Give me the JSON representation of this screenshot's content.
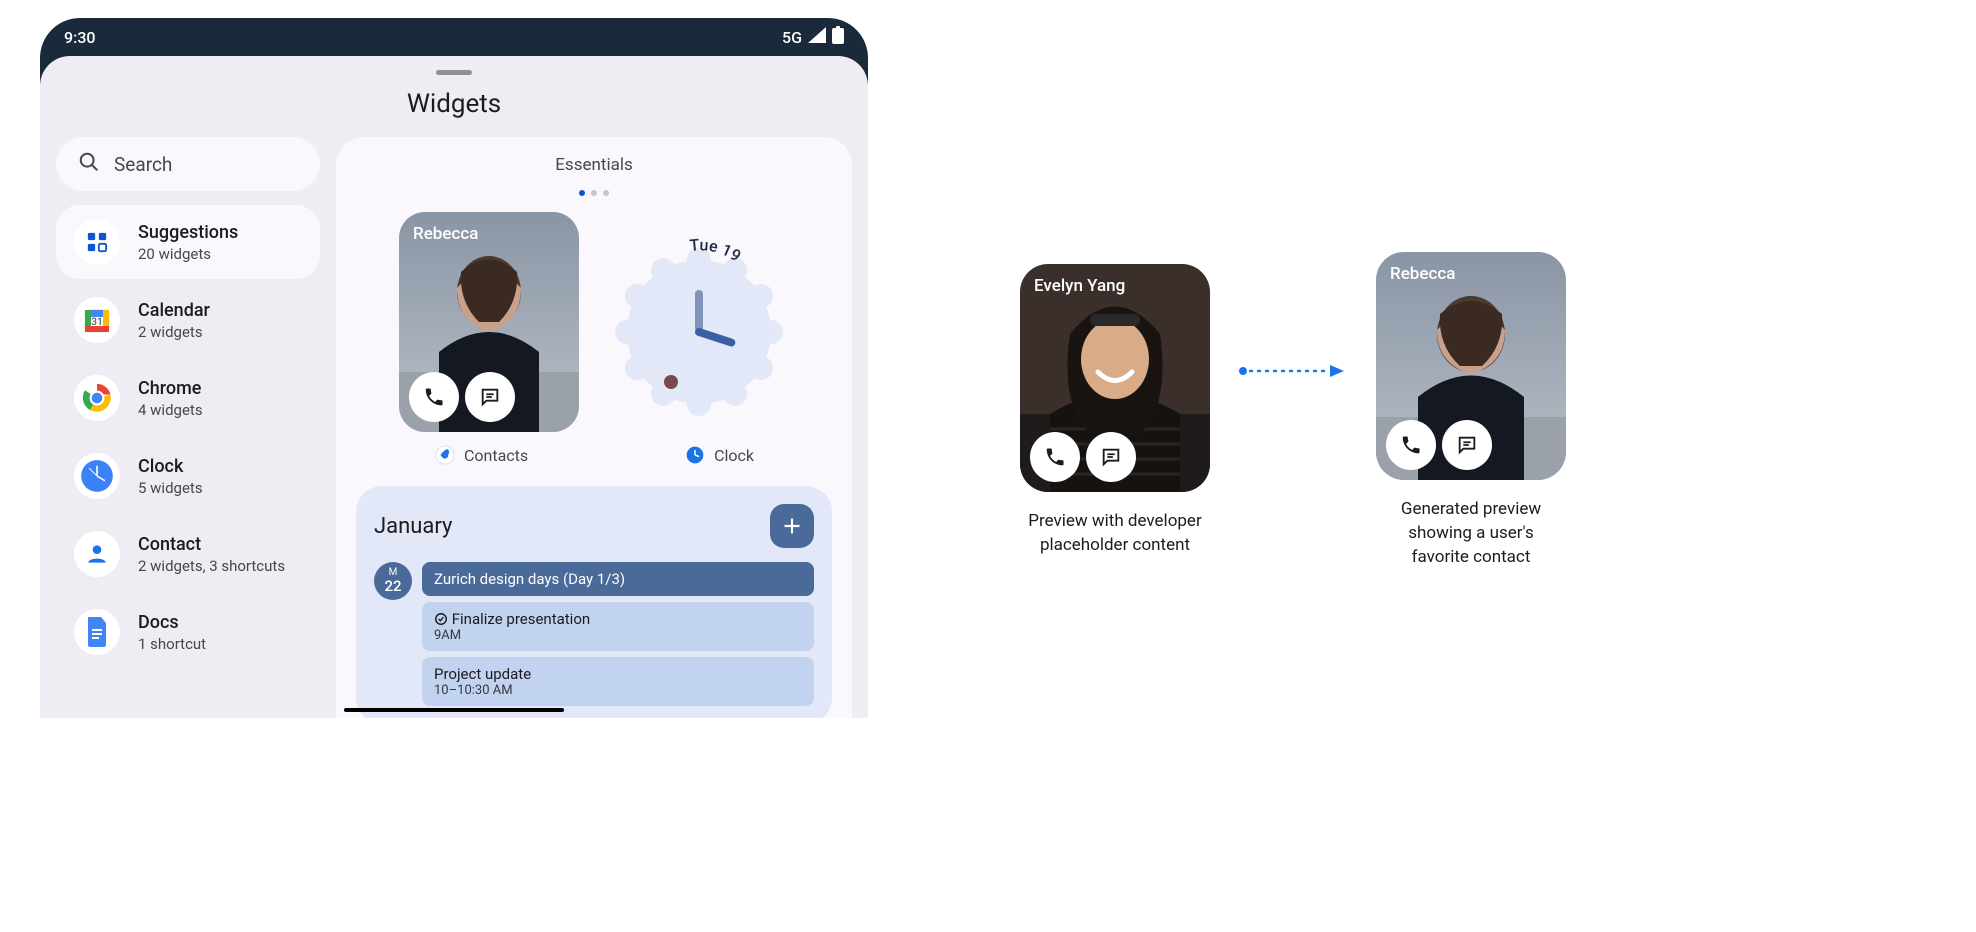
{
  "status": {
    "time": "9:30",
    "network": "5G"
  },
  "panel": {
    "title": "Widgets"
  },
  "search": {
    "placeholder": "Search"
  },
  "apps": [
    {
      "name": "Suggestions",
      "sub": "20 widgets"
    },
    {
      "name": "Calendar",
      "sub": "2 widgets"
    },
    {
      "name": "Chrome",
      "sub": "4 widgets"
    },
    {
      "name": "Clock",
      "sub": "5 widgets"
    },
    {
      "name": "Contact",
      "sub": "2 widgets, 3 shortcuts"
    },
    {
      "name": "Docs",
      "sub": "1 shortcut"
    }
  ],
  "essentials": {
    "title": "Essentials"
  },
  "contact_widget": {
    "name": "Rebecca"
  },
  "clock_widget": {
    "day": "Tue",
    "date": "19"
  },
  "widget_labels": {
    "contacts": "Contacts",
    "clock": "Clock"
  },
  "calendar": {
    "month": "January",
    "day_letter": "M",
    "day_num": "22",
    "events": [
      {
        "title": "Zurich design days (Day 1/3)",
        "time": ""
      },
      {
        "title": "Finalize presentation",
        "time": "9AM",
        "icon": true
      },
      {
        "title": "Project update",
        "time": "10–10:30 AM"
      }
    ]
  },
  "comparison": {
    "left": {
      "name": "Evelyn Yang",
      "caption": "Preview with developer placeholder content"
    },
    "right": {
      "name": "Rebecca",
      "caption": "Generated preview showing a user's favorite contact"
    }
  }
}
